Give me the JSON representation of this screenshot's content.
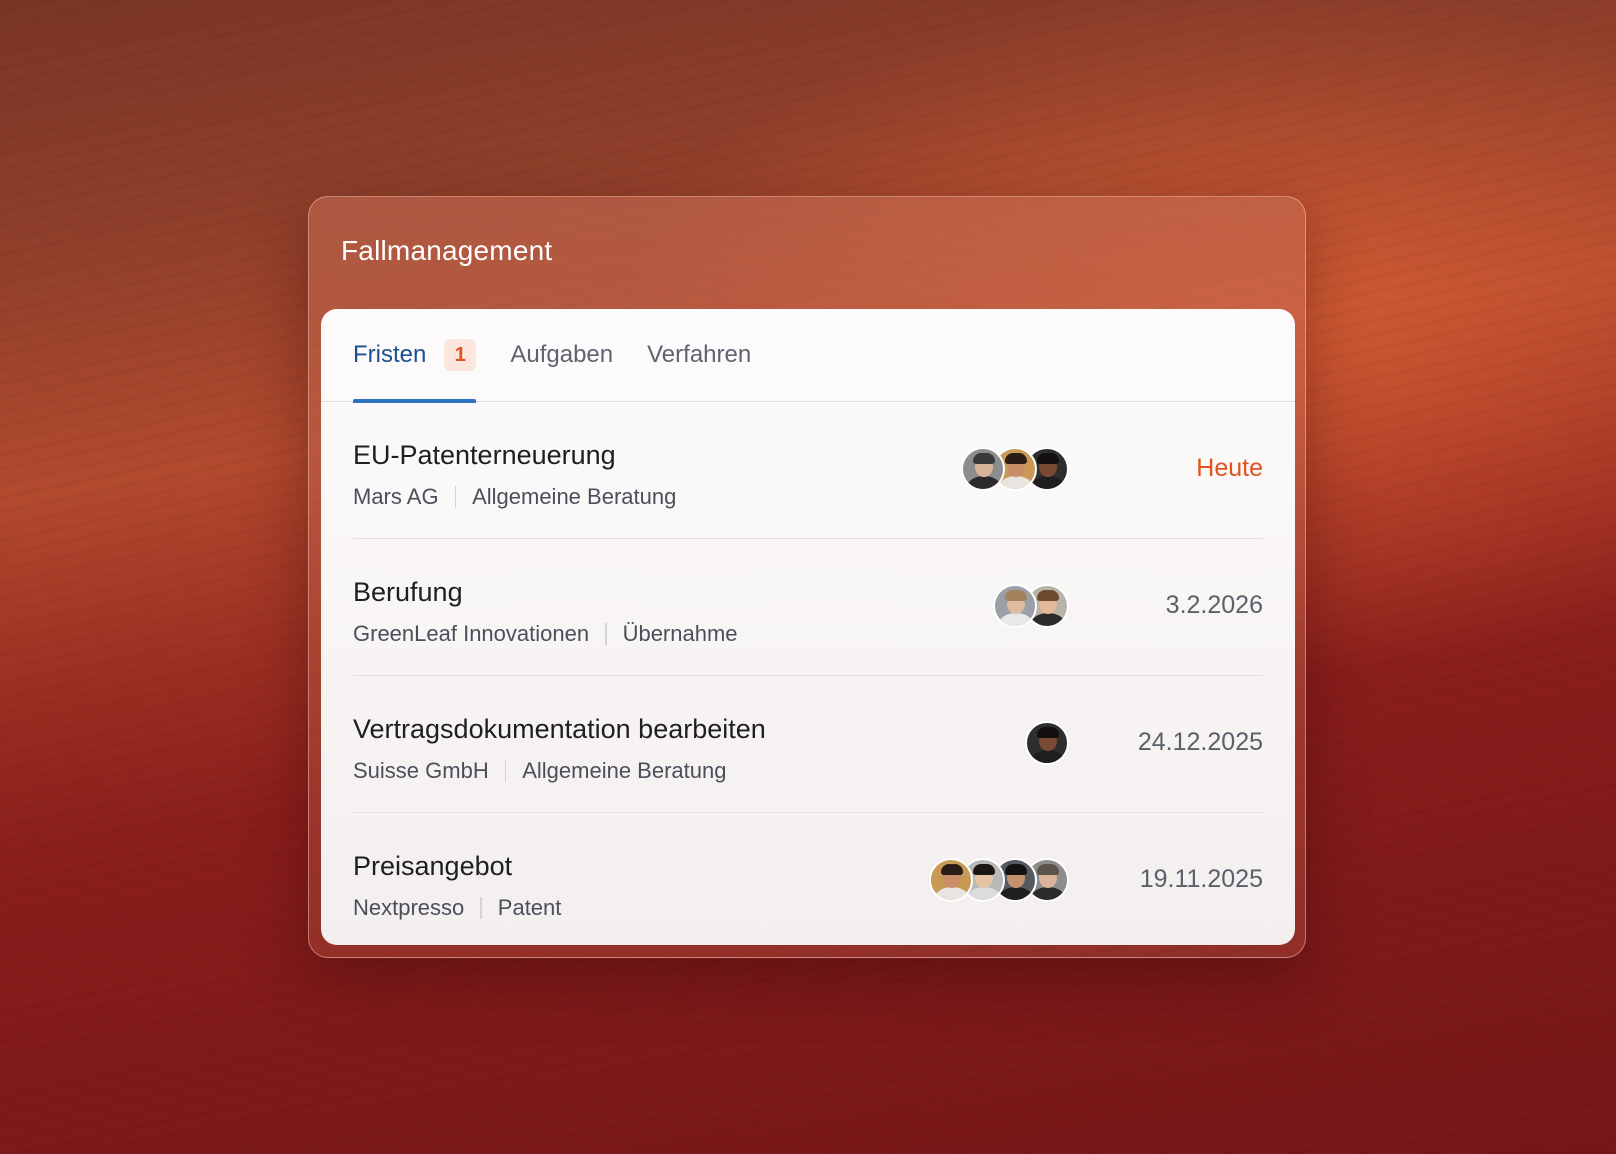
{
  "app": {
    "title": "Fallmanagement"
  },
  "tabs": [
    {
      "label": "Fristen",
      "badge": "1",
      "active": true
    },
    {
      "label": "Aufgaben",
      "active": false
    },
    {
      "label": "Verfahren",
      "active": false
    }
  ],
  "rows": [
    {
      "title": "EU-Patenterneuerung",
      "client": "Mars AG",
      "category": "Allgemeine Beratung",
      "date": "Heute",
      "avatars": [
        {
          "skin": "#d9b49a",
          "hair": "#3b3a3a",
          "shirt": "#2b2b2b",
          "bg": "#8d8d8d"
        },
        {
          "skin": "#c98e67",
          "hair": "#2a1d16",
          "shirt": "#e9e4df",
          "bg": "#c89a55"
        },
        {
          "skin": "#7a4a32",
          "hair": "#141010",
          "shirt": "#1e1e1e",
          "bg": "#2e2e2e"
        }
      ]
    },
    {
      "title": "Berufung",
      "client": "GreenLeaf Innovationen",
      "category": "Übernahme",
      "date": "3.2.2026",
      "avatars": [
        {
          "skin": "#e0bba0",
          "hair": "#a3825e",
          "shirt": "#e8e8ea",
          "bg": "#9aa0a6"
        },
        {
          "skin": "#e2b896",
          "hair": "#6b4a2f",
          "shirt": "#2a2a2a",
          "bg": "#b9b2a8"
        }
      ]
    },
    {
      "title": "Vertragsdokumentation bearbeiten",
      "client": "Suisse GmbH",
      "category": "Allgemeine Beratung",
      "date": "24.12.2025",
      "avatars": [
        {
          "skin": "#7a4a32",
          "hair": "#141010",
          "shirt": "#1e1e1e",
          "bg": "#2e2e2e"
        }
      ]
    },
    {
      "title": "Preisangebot",
      "client": "Nextpresso",
      "category": "Patent",
      "date": "19.11.2025",
      "avatars": [
        {
          "skin": "#c98e67",
          "hair": "#2a1d16",
          "shirt": "#e9e4df",
          "bg": "#c89a55"
        },
        {
          "skin": "#e6c3a5",
          "hair": "#1c1714",
          "shirt": "#dcdcdc",
          "bg": "#b8b8b8"
        },
        {
          "skin": "#c4926c",
          "hair": "#121212",
          "shirt": "#1f1f1f",
          "bg": "#555a60"
        },
        {
          "skin": "#d9b49a",
          "hair": "#5b524a",
          "shirt": "#2b2b2b",
          "bg": "#8d8d8d"
        }
      ]
    }
  ]
}
